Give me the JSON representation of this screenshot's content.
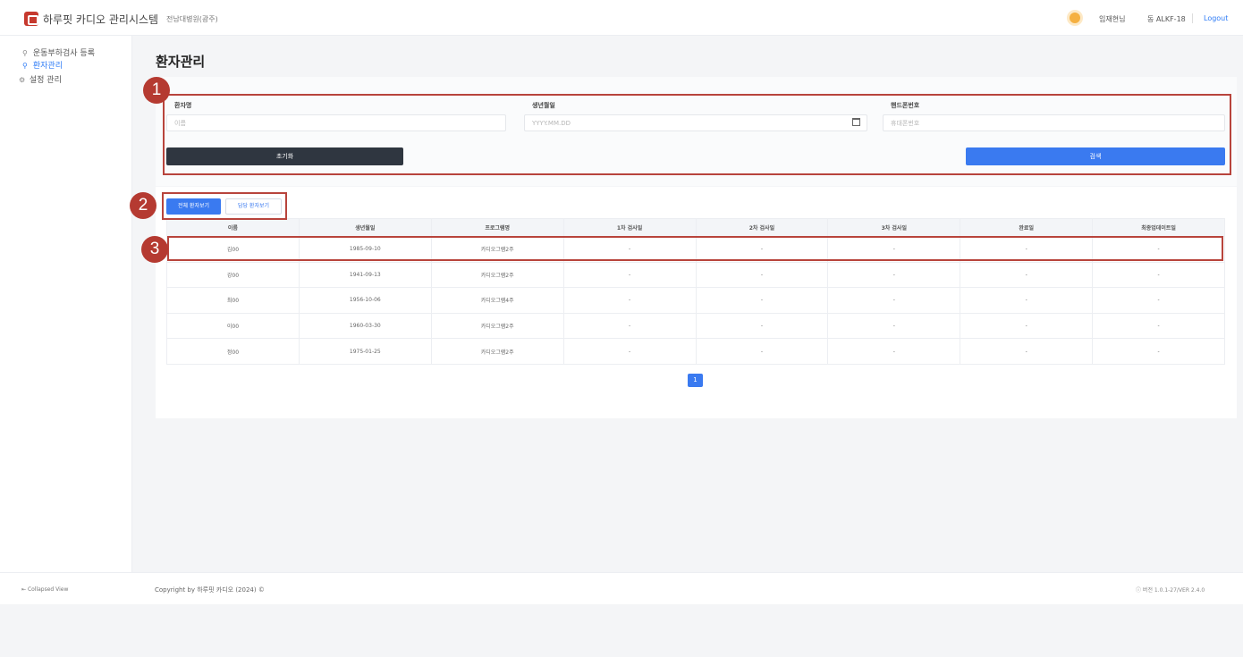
{
  "header": {
    "app_title": "하루핏 카디오 관리시스템",
    "app_subtitle": "전남대병원(광주)",
    "user": "임재현님",
    "device": "동 ALKF-18",
    "logout": "Logout"
  },
  "sidebar": {
    "items": [
      {
        "label": "운동부하검사 등록",
        "icon": "user-icon"
      },
      {
        "label": "환자관리",
        "icon": "user-icon"
      },
      {
        "label": "설정 관리",
        "icon": "gear-icon"
      }
    ],
    "collapse_label": "Collapsed View"
  },
  "page": {
    "title": "환자관리"
  },
  "search": {
    "name": {
      "label": "환자명",
      "placeholder": "이름"
    },
    "birth": {
      "label": "생년월일",
      "placeholder": "YYYY.MM.DD"
    },
    "phone": {
      "label": "핸드폰번호",
      "placeholder": "휴대폰번호"
    },
    "reset_label": "초기화",
    "search_label": "검색"
  },
  "tabs": {
    "all": "전체 환자보기",
    "done": "담당 환자보기"
  },
  "table": {
    "headers": [
      "이름",
      "생년월일",
      "프로그램명",
      "1차 검사일",
      "2차 검사일",
      "3차 검사일",
      "완료일",
      "최종업데이트일"
    ],
    "rows": [
      [
        "김00",
        "1985-09-10",
        "카디오그램2주",
        "-",
        "-",
        "-",
        "-",
        "-"
      ],
      [
        "강00",
        "1941-09-13",
        "카디오그램2주",
        "-",
        "-",
        "-",
        "-",
        "-"
      ],
      [
        "최00",
        "1956-10-06",
        "카디오그램4주",
        "-",
        "-",
        "-",
        "-",
        "-"
      ],
      [
        "이00",
        "1960-03-30",
        "카디오그램2주",
        "-",
        "-",
        "-",
        "-",
        "-"
      ],
      [
        "정00",
        "1975-01-25",
        "카디오그램2주",
        "-",
        "-",
        "-",
        "-",
        "-"
      ]
    ]
  },
  "pagination": {
    "current": "1"
  },
  "footer": {
    "copyright": "Copyright by 하루핏 카디오 (2024) ©",
    "version": "버전 1.0.1-27/VER 2.4.0"
  },
  "annotations": [
    "1",
    "2",
    "3"
  ],
  "colors": {
    "accent": "#3a7af0",
    "dark_button": "#2f3640",
    "annotation": "#b8443c",
    "logo": "#c6392e"
  }
}
